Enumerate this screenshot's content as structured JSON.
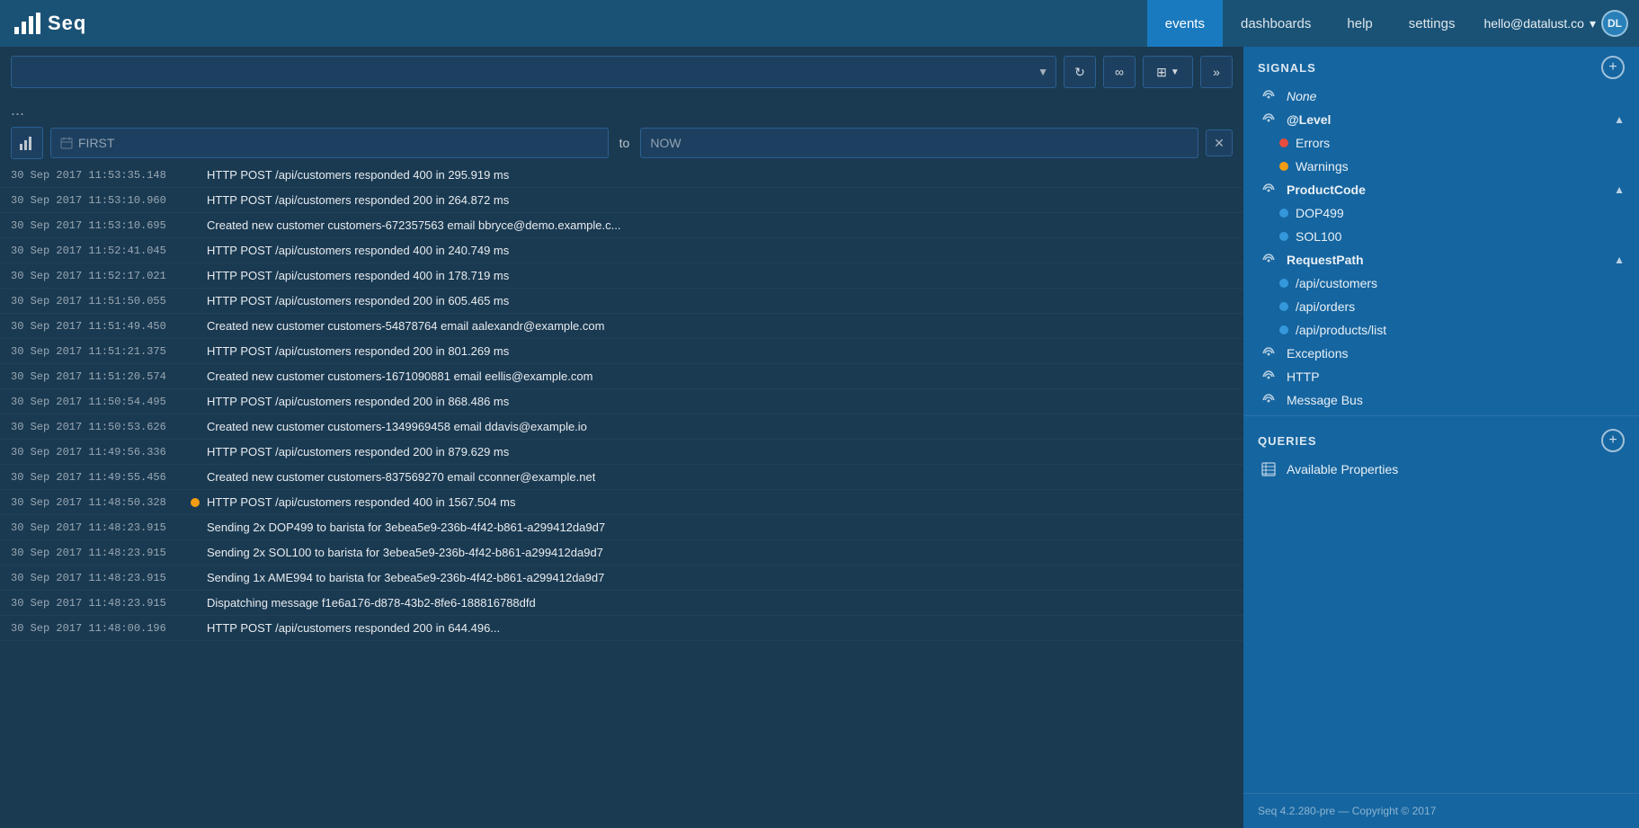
{
  "nav": {
    "logo_text": "Seq",
    "items": [
      {
        "label": "events",
        "active": true
      },
      {
        "label": "dashboards",
        "active": false
      },
      {
        "label": "help",
        "active": false
      },
      {
        "label": "settings",
        "active": false
      }
    ],
    "user_email": "hello@datalust.co",
    "user_caret": "▾"
  },
  "search": {
    "placeholder": "",
    "dropdown_arrow": "▼"
  },
  "toolbar": {
    "refresh": "↻",
    "infinity": "∞",
    "grid": "⊞",
    "grid_dropdown": "▼",
    "forward": "»"
  },
  "date_bar": {
    "chart_icon": "▦",
    "from_placeholder": "FIRST",
    "separator": "to",
    "to_placeholder": "NOW",
    "clear": "✕"
  },
  "dots": "...",
  "events": [
    {
      "timestamp": "30 Sep 2017  11:53:35.148",
      "dot": "none",
      "message": "HTTP POST /api/customers responded 400 in 295.919 ms"
    },
    {
      "timestamp": "30 Sep 2017  11:53:10.960",
      "dot": "none",
      "message": "HTTP POST /api/customers responded 200 in 264.872 ms"
    },
    {
      "timestamp": "30 Sep 2017  11:53:10.695",
      "dot": "none",
      "message": "Created new customer customers-672357563 email bbryce@demo.example.c..."
    },
    {
      "timestamp": "30 Sep 2017  11:52:41.045",
      "dot": "none",
      "message": "HTTP POST /api/customers responded 400 in 240.749 ms"
    },
    {
      "timestamp": "30 Sep 2017  11:52:17.021",
      "dot": "none",
      "message": "HTTP POST /api/customers responded 400 in 178.719 ms"
    },
    {
      "timestamp": "30 Sep 2017  11:51:50.055",
      "dot": "none",
      "message": "HTTP POST /api/customers responded 200 in 605.465 ms"
    },
    {
      "timestamp": "30 Sep 2017  11:51:49.450",
      "dot": "none",
      "message": "Created new customer customers-54878764 email aalexandr@example.com"
    },
    {
      "timestamp": "30 Sep 2017  11:51:21.375",
      "dot": "none",
      "message": "HTTP POST /api/customers responded 200 in 801.269 ms"
    },
    {
      "timestamp": "30 Sep 2017  11:51:20.574",
      "dot": "none",
      "message": "Created new customer customers-1671090881 email eellis@example.com"
    },
    {
      "timestamp": "30 Sep 2017  11:50:54.495",
      "dot": "none",
      "message": "HTTP POST /api/customers responded 200 in 868.486 ms"
    },
    {
      "timestamp": "30 Sep 2017  11:50:53.626",
      "dot": "none",
      "message": "Created new customer customers-1349969458 email ddavis@example.io"
    },
    {
      "timestamp": "30 Sep 2017  11:49:56.336",
      "dot": "none",
      "message": "HTTP POST /api/customers responded 200 in 879.629 ms"
    },
    {
      "timestamp": "30 Sep 2017  11:49:55.456",
      "dot": "none",
      "message": "Created new customer customers-837569270 email cconner@example.net"
    },
    {
      "timestamp": "30 Sep 2017  11:48:50.328",
      "dot": "warn",
      "message": "HTTP POST /api/customers responded 400 in 1567.504 ms"
    },
    {
      "timestamp": "30 Sep 2017  11:48:23.915",
      "dot": "none",
      "message": "Sending 2x DOP499 to barista for 3ebea5e9-236b-4f42-b861-a299412da9d7"
    },
    {
      "timestamp": "30 Sep 2017  11:48:23.915",
      "dot": "none",
      "message": "Sending 2x SOL100 to barista for 3ebea5e9-236b-4f42-b861-a299412da9d7"
    },
    {
      "timestamp": "30 Sep 2017  11:48:23.915",
      "dot": "none",
      "message": "Sending 1x AME994 to barista for 3ebea5e9-236b-4f42-b861-a299412da9d7"
    },
    {
      "timestamp": "30 Sep 2017  11:48:23.915",
      "dot": "none",
      "message": "Dispatching message f1e6a176-d878-43b2-8fe6-188816788dfd"
    },
    {
      "timestamp": "30 Sep 2017  11:48:00.196",
      "dot": "none",
      "message": "HTTP POST /api/customers responded 200 in 644.496..."
    }
  ],
  "signals": {
    "section_title": "SIGNALS",
    "add_btn": "+",
    "items": [
      {
        "type": "radio",
        "label": "None",
        "italic": true
      },
      {
        "type": "group_header",
        "label": "@Level",
        "bold": true,
        "expanded": false
      },
      {
        "type": "dot",
        "dot_color": "red",
        "label": "Errors"
      },
      {
        "type": "dot",
        "dot_color": "yellow",
        "label": "Warnings"
      },
      {
        "type": "group_header",
        "label": "ProductCode",
        "bold": true,
        "expanded": false
      },
      {
        "type": "dot",
        "dot_color": "blue",
        "label": "DOP499"
      },
      {
        "type": "dot",
        "dot_color": "blue",
        "label": "SOL100"
      },
      {
        "type": "group_header",
        "label": "RequestPath",
        "bold": true,
        "expanded": false
      },
      {
        "type": "dot",
        "dot_color": "blue",
        "label": "/api/customers"
      },
      {
        "type": "dot",
        "dot_color": "blue",
        "label": "/api/orders"
      },
      {
        "type": "dot",
        "dot_color": "blue",
        "label": "/api/products/list"
      },
      {
        "type": "radio",
        "label": "Exceptions"
      },
      {
        "type": "radio",
        "label": "HTTP"
      },
      {
        "type": "radio",
        "label": "Message Bus"
      }
    ]
  },
  "queries": {
    "section_title": "QUERIES",
    "add_btn": "+",
    "item_label": "Available Properties"
  },
  "footer": {
    "text": "Seq 4.2.280-pre — Copyright © 2017"
  }
}
